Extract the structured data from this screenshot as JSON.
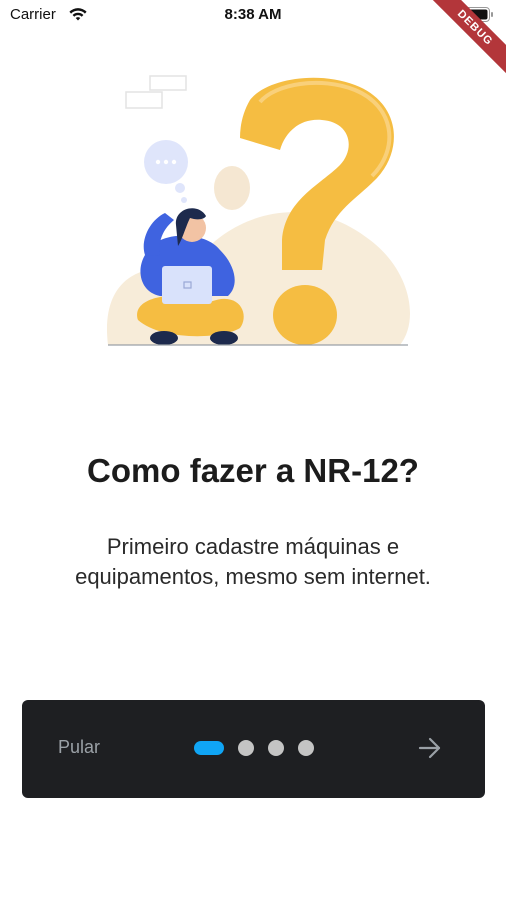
{
  "status_bar": {
    "carrier": "Carrier",
    "time": "8:38 AM",
    "wifi_icon": "wifi-icon",
    "battery_icon": "battery-icon"
  },
  "debug_banner": {
    "label": "DEBUG"
  },
  "onboarding": {
    "illustration_icon": "person-thinking-question-mark-illustration",
    "title": "Como fazer a NR-12?",
    "description": "Primeiro cadastre máquinas e equipamentos, mesmo sem internet."
  },
  "bottom_bar": {
    "skip_label": "Pular",
    "page_indicator": {
      "total_pages": 4,
      "current_page": 1
    },
    "next_icon": "arrow-right-icon"
  },
  "colors": {
    "accent": "#10a5f5",
    "bar_background": "#1e1f22",
    "question_mark": "#f5bd42",
    "debug_ribbon": "#b3363a"
  }
}
